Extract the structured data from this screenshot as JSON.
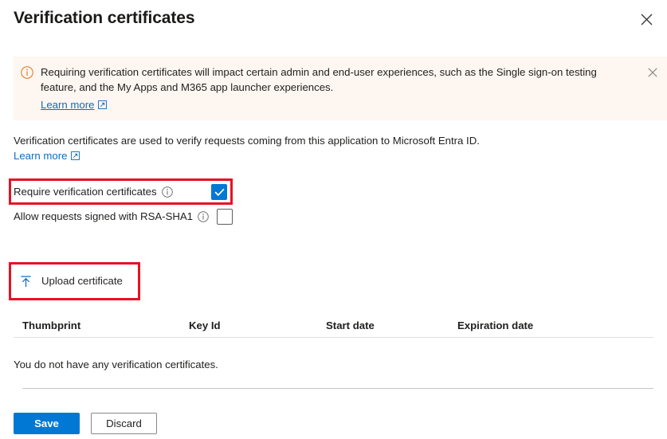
{
  "header": {
    "title": "Verification certificates",
    "close_icon": "close-icon"
  },
  "banner": {
    "icon": "info-circle-icon",
    "text": "Requiring verification certificates will impact certain admin and end-user experiences, such as the Single sign-on testing feature, and the My Apps and M365 app launcher experiences.",
    "link_label": "Learn more",
    "link_icon": "external-link-icon",
    "close_icon": "close-icon",
    "background_color": "#fdf6f1",
    "icon_color": "#d8741a"
  },
  "description": {
    "text": "Verification certificates are used to verify requests coming from this application to Microsoft Entra ID.",
    "link_label": "Learn more",
    "link_icon": "external-link-icon"
  },
  "options": [
    {
      "label": "Require verification certificates",
      "info_icon": "info-circle-icon",
      "checked": true,
      "checkbox_color": "#0078d4"
    },
    {
      "label": "Allow requests signed with RSA-SHA1",
      "info_icon": "info-circle-icon",
      "checked": false,
      "checkbox_color": "#ffffff"
    }
  ],
  "upload": {
    "label": "Upload certificate",
    "icon": "upload-arrow-icon",
    "icon_color": "#0f6cbd"
  },
  "table": {
    "columns": [
      "Thumbprint",
      "Key Id",
      "Start date",
      "Expiration date"
    ],
    "rows": [],
    "empty_message": "You do not have any verification certificates."
  },
  "footer": {
    "save_label": "Save",
    "discard_label": "Discard",
    "primary_color": "#0078d4"
  },
  "annotations": {
    "color": "#e81123",
    "boxes": [
      "require-verification-certificates-row",
      "upload-certificate-button"
    ]
  }
}
